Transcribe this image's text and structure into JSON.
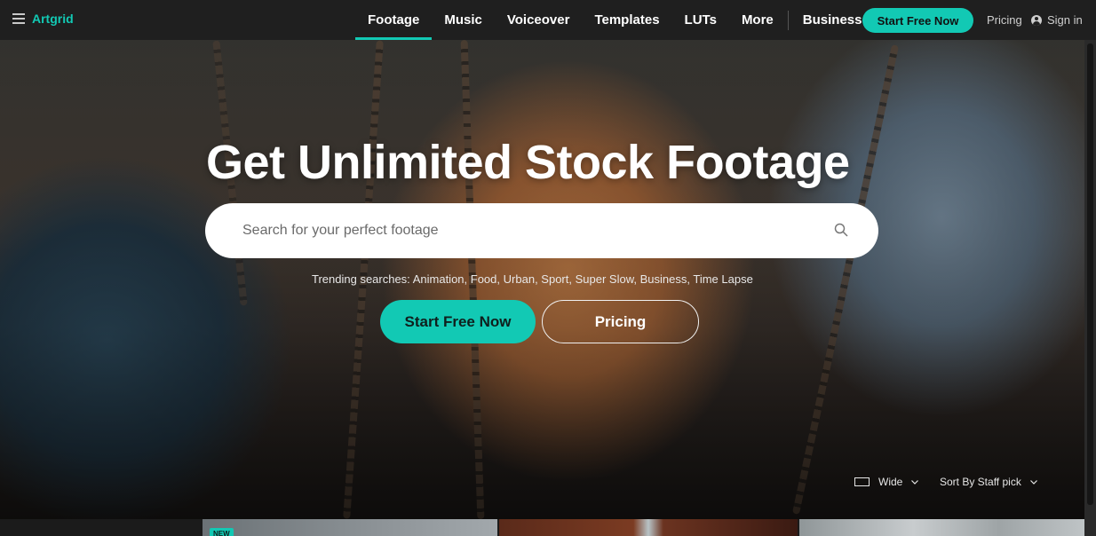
{
  "nav": {
    "logo": "Artgrid",
    "tabs": [
      {
        "label": "Footage",
        "active": true
      },
      {
        "label": "Music"
      },
      {
        "label": "Voiceover"
      },
      {
        "label": "Templates"
      },
      {
        "label": "LUTs"
      },
      {
        "label": "More"
      },
      {
        "label": "Business"
      }
    ],
    "cta": "Start Free Now",
    "pricing": "Pricing",
    "signin": "Sign in"
  },
  "hero": {
    "headline": "Get Unlimited Stock Footage",
    "search_placeholder": "Search for your perfect footage",
    "trending_label": "Trending searches:",
    "trending": [
      "Animation",
      "Food",
      "Urban",
      "Sport",
      "Super Slow",
      "Business",
      "Time Lapse"
    ],
    "primary_button": "Start Free Now",
    "secondary_button": "Pricing"
  },
  "controls": {
    "view": "Wide",
    "sort": "Sort By Staff pick"
  },
  "thumbnails": {
    "badge": "NEW"
  },
  "colors": {
    "accent": "#12c9b4",
    "nav_bg": "#1f1f1f"
  }
}
